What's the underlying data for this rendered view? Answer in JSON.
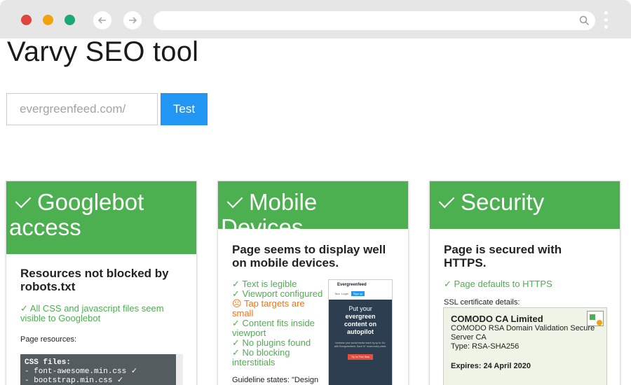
{
  "browser": {
    "url": ""
  },
  "page": {
    "title": "Varvy SEO tool",
    "search": {
      "placeholder": "evergreenfeed.com/"
    },
    "test_button": "Test"
  },
  "cards": [
    {
      "title_line1": "Googlebot",
      "title_line2": "access",
      "subtitle": "Resources not blocked by robots.txt",
      "status": "All CSS and javascript files seem visible to Googlebot",
      "resources_label": "Page resources:",
      "code": {
        "heading": "CSS files:",
        "lines": [
          "- font-awesome.min.css ✓",
          "- bootstrap.min.css ✓"
        ]
      }
    },
    {
      "title": "Mobile Devices",
      "subtitle": "Page seems to display well on mobile devices.",
      "checks": [
        {
          "text": "Text is legible",
          "status": "ok"
        },
        {
          "text": "Viewport configured",
          "status": "ok"
        },
        {
          "text": "Tap targets are small",
          "status": "warn"
        },
        {
          "text": "Content fits inside viewport",
          "status": "ok"
        },
        {
          "text": "No plugins found",
          "status": "ok"
        },
        {
          "text": "No blocking interstitials",
          "status": "ok"
        }
      ],
      "guideline": "Guideline states: \"Design",
      "phone": {
        "brand": "Evergreenfeed",
        "nav": [
          "Tour",
          "Login"
        ],
        "signup": "Sign up",
        "hero_line1": "Put your",
        "hero_line2": "evergreen",
        "hero_line3": "content on",
        "hero_line4": "autopilot",
        "hero_text": "Increase your social media reach by up to 11x with Evergreenfeed. Save 5+ hours every week.",
        "cta": "Try for Free Now"
      }
    },
    {
      "title": "Security",
      "subtitle": "Page is secured with HTTPS.",
      "status": "Page defaults to HTTPS",
      "ssl_label": "SSL certificate details:",
      "cert": {
        "name": "COMODO CA Limited",
        "line1": "COMODO RSA Domain Validation Secure",
        "line2": "Server CA",
        "type": "Type: RSA-SHA256",
        "expires": "Expires: 24 April 2020"
      }
    }
  ],
  "colors": {
    "accent_green": "#4caf50",
    "button_blue": "#2196f3",
    "warning_orange": "#ff6f00"
  }
}
